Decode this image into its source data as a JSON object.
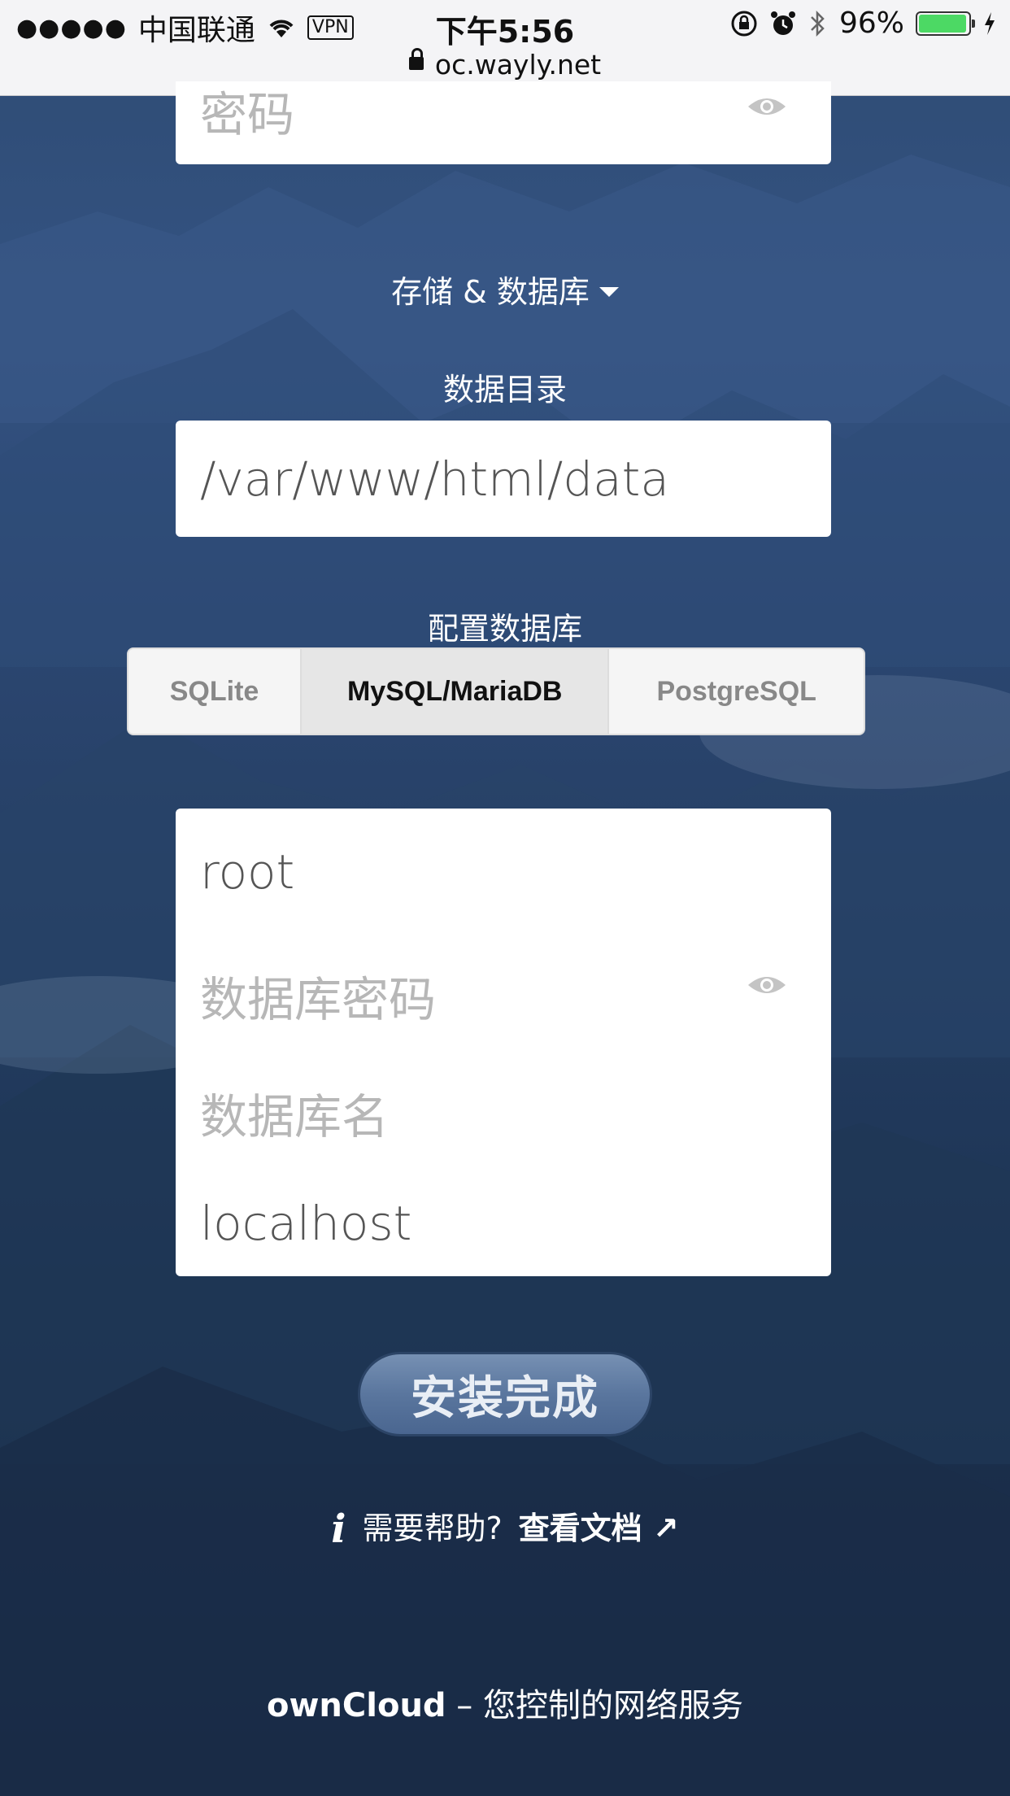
{
  "status_bar": {
    "signal": "●●●●●",
    "carrier": "中国联通",
    "vpn": "VPN",
    "time": "下午5:56",
    "battery_percent": "96%",
    "battery_level": 0.96,
    "url": "oc.wayly.net"
  },
  "admin_password": {
    "placeholder": "密码"
  },
  "storage_toggle": {
    "label": "存储 & 数据库"
  },
  "data_directory": {
    "label": "数据目录",
    "value": "/var/www/html/data"
  },
  "database": {
    "label": "配置数据库",
    "tabs": [
      {
        "label": "SQLite",
        "active": false
      },
      {
        "label": "MySQL/MariaDB",
        "active": true
      },
      {
        "label": "PostgreSQL",
        "active": false
      }
    ],
    "user": "root",
    "password_placeholder": "数据库密码",
    "name_placeholder": "数据库名",
    "host": "localhost"
  },
  "submit": {
    "label": "安装完成"
  },
  "help": {
    "text": "需要帮助?",
    "link": "查看文档 ↗"
  },
  "footer": {
    "brand": "ownCloud",
    "separator": "–",
    "tagline": "您控制的网络服务"
  }
}
